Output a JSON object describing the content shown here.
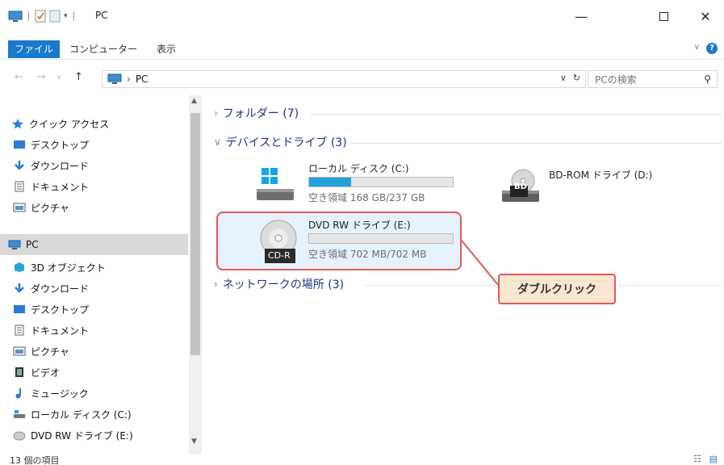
{
  "window": {
    "title": "PC"
  },
  "ribbon": {
    "tabs": [
      "ファイル",
      "コンピューター",
      "表示"
    ],
    "help": "?"
  },
  "address": {
    "path": "PC",
    "search_placeholder": "PCの検索"
  },
  "nav": {
    "items": [
      {
        "label": "クイック アクセス"
      },
      {
        "label": "デスクトップ"
      },
      {
        "label": "ダウンロード"
      },
      {
        "label": "ドキュメント"
      },
      {
        "label": "ピクチャ"
      },
      {
        "label": "PC"
      },
      {
        "label": "3D オブジェクト"
      },
      {
        "label": "ダウンロード"
      },
      {
        "label": "デスクトップ"
      },
      {
        "label": "ドキュメント"
      },
      {
        "label": "ピクチャ"
      },
      {
        "label": "ビデオ"
      },
      {
        "label": "ミュージック"
      },
      {
        "label": "ローカル ディスク (C:)"
      },
      {
        "label": "DVD RW ドライブ (E:)"
      }
    ]
  },
  "groups": {
    "folders": "フォルダー (7)",
    "devices": "デバイスとドライブ (3)",
    "network": "ネットワークの場所 (3)"
  },
  "drives": {
    "c": {
      "name": "ローカル ディスク (C:)",
      "free": "空き領域 168 GB/237 GB",
      "used_fraction": 0.29
    },
    "d": {
      "name": "BD-ROM ドライブ (D:)",
      "badge": "BD"
    },
    "e": {
      "name": "DVD RW ドライブ (E:)",
      "free": "空き領域 702 MB/702 MB",
      "badge": "CD-R",
      "used_fraction": 0
    }
  },
  "callout": {
    "text": "ダブルクリック"
  },
  "status": {
    "count": "13 個の項目"
  },
  "colors": {
    "accent": "#1979ca",
    "highlight_border": "#e05a5a",
    "callout_bg": "#fbe6d0",
    "selection_bg": "#e5f1fb"
  }
}
